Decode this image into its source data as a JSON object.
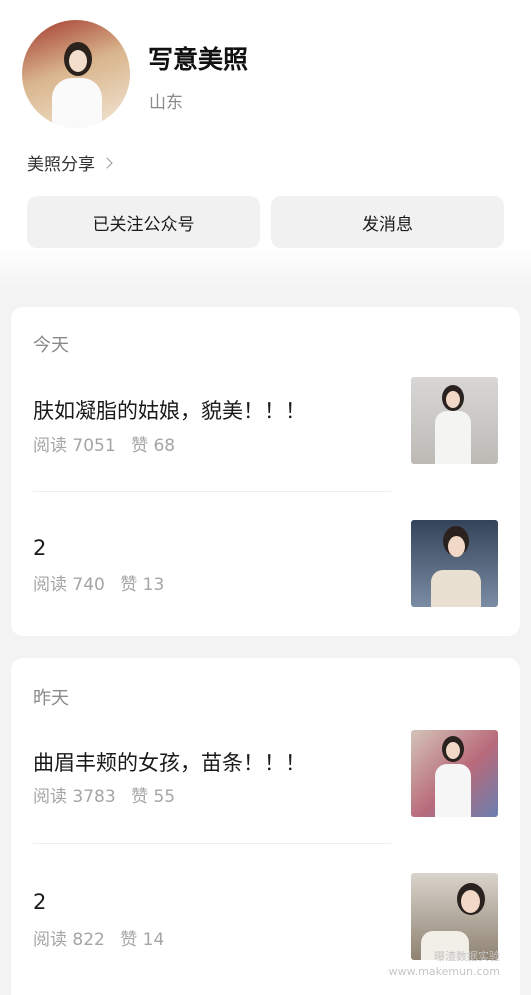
{
  "profile": {
    "name": "写意美照",
    "location": "山东",
    "category": "美照分享"
  },
  "actions": {
    "follow_label": "已关注公众号",
    "message_label": "发消息"
  },
  "groups": [
    {
      "day": "今天",
      "articles": [
        {
          "title": "肤如凝脂的姑娘，貌美！！！",
          "reads": "阅读 7051",
          "likes": "赞 68"
        },
        {
          "title": "2",
          "reads": "阅读 740",
          "likes": "赞 13"
        }
      ]
    },
    {
      "day": "昨天",
      "articles": [
        {
          "title": "曲眉丰颊的女孩，苗条！！！",
          "reads": "阅读 3783",
          "likes": "赞 55"
        },
        {
          "title": "2",
          "reads": "阅读 822",
          "likes": "赞 14"
        }
      ]
    }
  ],
  "watermark": {
    "line1": "曝渣数据实验",
    "line2": "www.makemun.com"
  }
}
